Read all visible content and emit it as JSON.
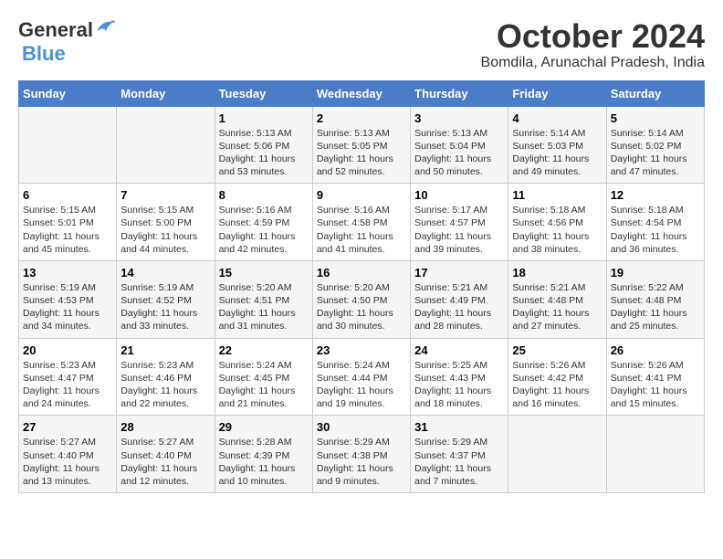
{
  "header": {
    "logo_line1": "General",
    "logo_line2": "Blue",
    "month_title": "October 2024",
    "location": "Bomdila, Arunachal Pradesh, India"
  },
  "days_of_week": [
    "Sunday",
    "Monday",
    "Tuesday",
    "Wednesday",
    "Thursday",
    "Friday",
    "Saturday"
  ],
  "weeks": [
    [
      {
        "num": "",
        "text": ""
      },
      {
        "num": "",
        "text": ""
      },
      {
        "num": "1",
        "text": "Sunrise: 5:13 AM\nSunset: 5:06 PM\nDaylight: 11 hours and 53 minutes."
      },
      {
        "num": "2",
        "text": "Sunrise: 5:13 AM\nSunset: 5:05 PM\nDaylight: 11 hours and 52 minutes."
      },
      {
        "num": "3",
        "text": "Sunrise: 5:13 AM\nSunset: 5:04 PM\nDaylight: 11 hours and 50 minutes."
      },
      {
        "num": "4",
        "text": "Sunrise: 5:14 AM\nSunset: 5:03 PM\nDaylight: 11 hours and 49 minutes."
      },
      {
        "num": "5",
        "text": "Sunrise: 5:14 AM\nSunset: 5:02 PM\nDaylight: 11 hours and 47 minutes."
      }
    ],
    [
      {
        "num": "6",
        "text": "Sunrise: 5:15 AM\nSunset: 5:01 PM\nDaylight: 11 hours and 45 minutes."
      },
      {
        "num": "7",
        "text": "Sunrise: 5:15 AM\nSunset: 5:00 PM\nDaylight: 11 hours and 44 minutes."
      },
      {
        "num": "8",
        "text": "Sunrise: 5:16 AM\nSunset: 4:59 PM\nDaylight: 11 hours and 42 minutes."
      },
      {
        "num": "9",
        "text": "Sunrise: 5:16 AM\nSunset: 4:58 PM\nDaylight: 11 hours and 41 minutes."
      },
      {
        "num": "10",
        "text": "Sunrise: 5:17 AM\nSunset: 4:57 PM\nDaylight: 11 hours and 39 minutes."
      },
      {
        "num": "11",
        "text": "Sunrise: 5:18 AM\nSunset: 4:56 PM\nDaylight: 11 hours and 38 minutes."
      },
      {
        "num": "12",
        "text": "Sunrise: 5:18 AM\nSunset: 4:54 PM\nDaylight: 11 hours and 36 minutes."
      }
    ],
    [
      {
        "num": "13",
        "text": "Sunrise: 5:19 AM\nSunset: 4:53 PM\nDaylight: 11 hours and 34 minutes."
      },
      {
        "num": "14",
        "text": "Sunrise: 5:19 AM\nSunset: 4:52 PM\nDaylight: 11 hours and 33 minutes."
      },
      {
        "num": "15",
        "text": "Sunrise: 5:20 AM\nSunset: 4:51 PM\nDaylight: 11 hours and 31 minutes."
      },
      {
        "num": "16",
        "text": "Sunrise: 5:20 AM\nSunset: 4:50 PM\nDaylight: 11 hours and 30 minutes."
      },
      {
        "num": "17",
        "text": "Sunrise: 5:21 AM\nSunset: 4:49 PM\nDaylight: 11 hours and 28 minutes."
      },
      {
        "num": "18",
        "text": "Sunrise: 5:21 AM\nSunset: 4:48 PM\nDaylight: 11 hours and 27 minutes."
      },
      {
        "num": "19",
        "text": "Sunrise: 5:22 AM\nSunset: 4:48 PM\nDaylight: 11 hours and 25 minutes."
      }
    ],
    [
      {
        "num": "20",
        "text": "Sunrise: 5:23 AM\nSunset: 4:47 PM\nDaylight: 11 hours and 24 minutes."
      },
      {
        "num": "21",
        "text": "Sunrise: 5:23 AM\nSunset: 4:46 PM\nDaylight: 11 hours and 22 minutes."
      },
      {
        "num": "22",
        "text": "Sunrise: 5:24 AM\nSunset: 4:45 PM\nDaylight: 11 hours and 21 minutes."
      },
      {
        "num": "23",
        "text": "Sunrise: 5:24 AM\nSunset: 4:44 PM\nDaylight: 11 hours and 19 minutes."
      },
      {
        "num": "24",
        "text": "Sunrise: 5:25 AM\nSunset: 4:43 PM\nDaylight: 11 hours and 18 minutes."
      },
      {
        "num": "25",
        "text": "Sunrise: 5:26 AM\nSunset: 4:42 PM\nDaylight: 11 hours and 16 minutes."
      },
      {
        "num": "26",
        "text": "Sunrise: 5:26 AM\nSunset: 4:41 PM\nDaylight: 11 hours and 15 minutes."
      }
    ],
    [
      {
        "num": "27",
        "text": "Sunrise: 5:27 AM\nSunset: 4:40 PM\nDaylight: 11 hours and 13 minutes."
      },
      {
        "num": "28",
        "text": "Sunrise: 5:27 AM\nSunset: 4:40 PM\nDaylight: 11 hours and 12 minutes."
      },
      {
        "num": "29",
        "text": "Sunrise: 5:28 AM\nSunset: 4:39 PM\nDaylight: 11 hours and 10 minutes."
      },
      {
        "num": "30",
        "text": "Sunrise: 5:29 AM\nSunset: 4:38 PM\nDaylight: 11 hours and 9 minutes."
      },
      {
        "num": "31",
        "text": "Sunrise: 5:29 AM\nSunset: 4:37 PM\nDaylight: 11 hours and 7 minutes."
      },
      {
        "num": "",
        "text": ""
      },
      {
        "num": "",
        "text": ""
      }
    ]
  ]
}
